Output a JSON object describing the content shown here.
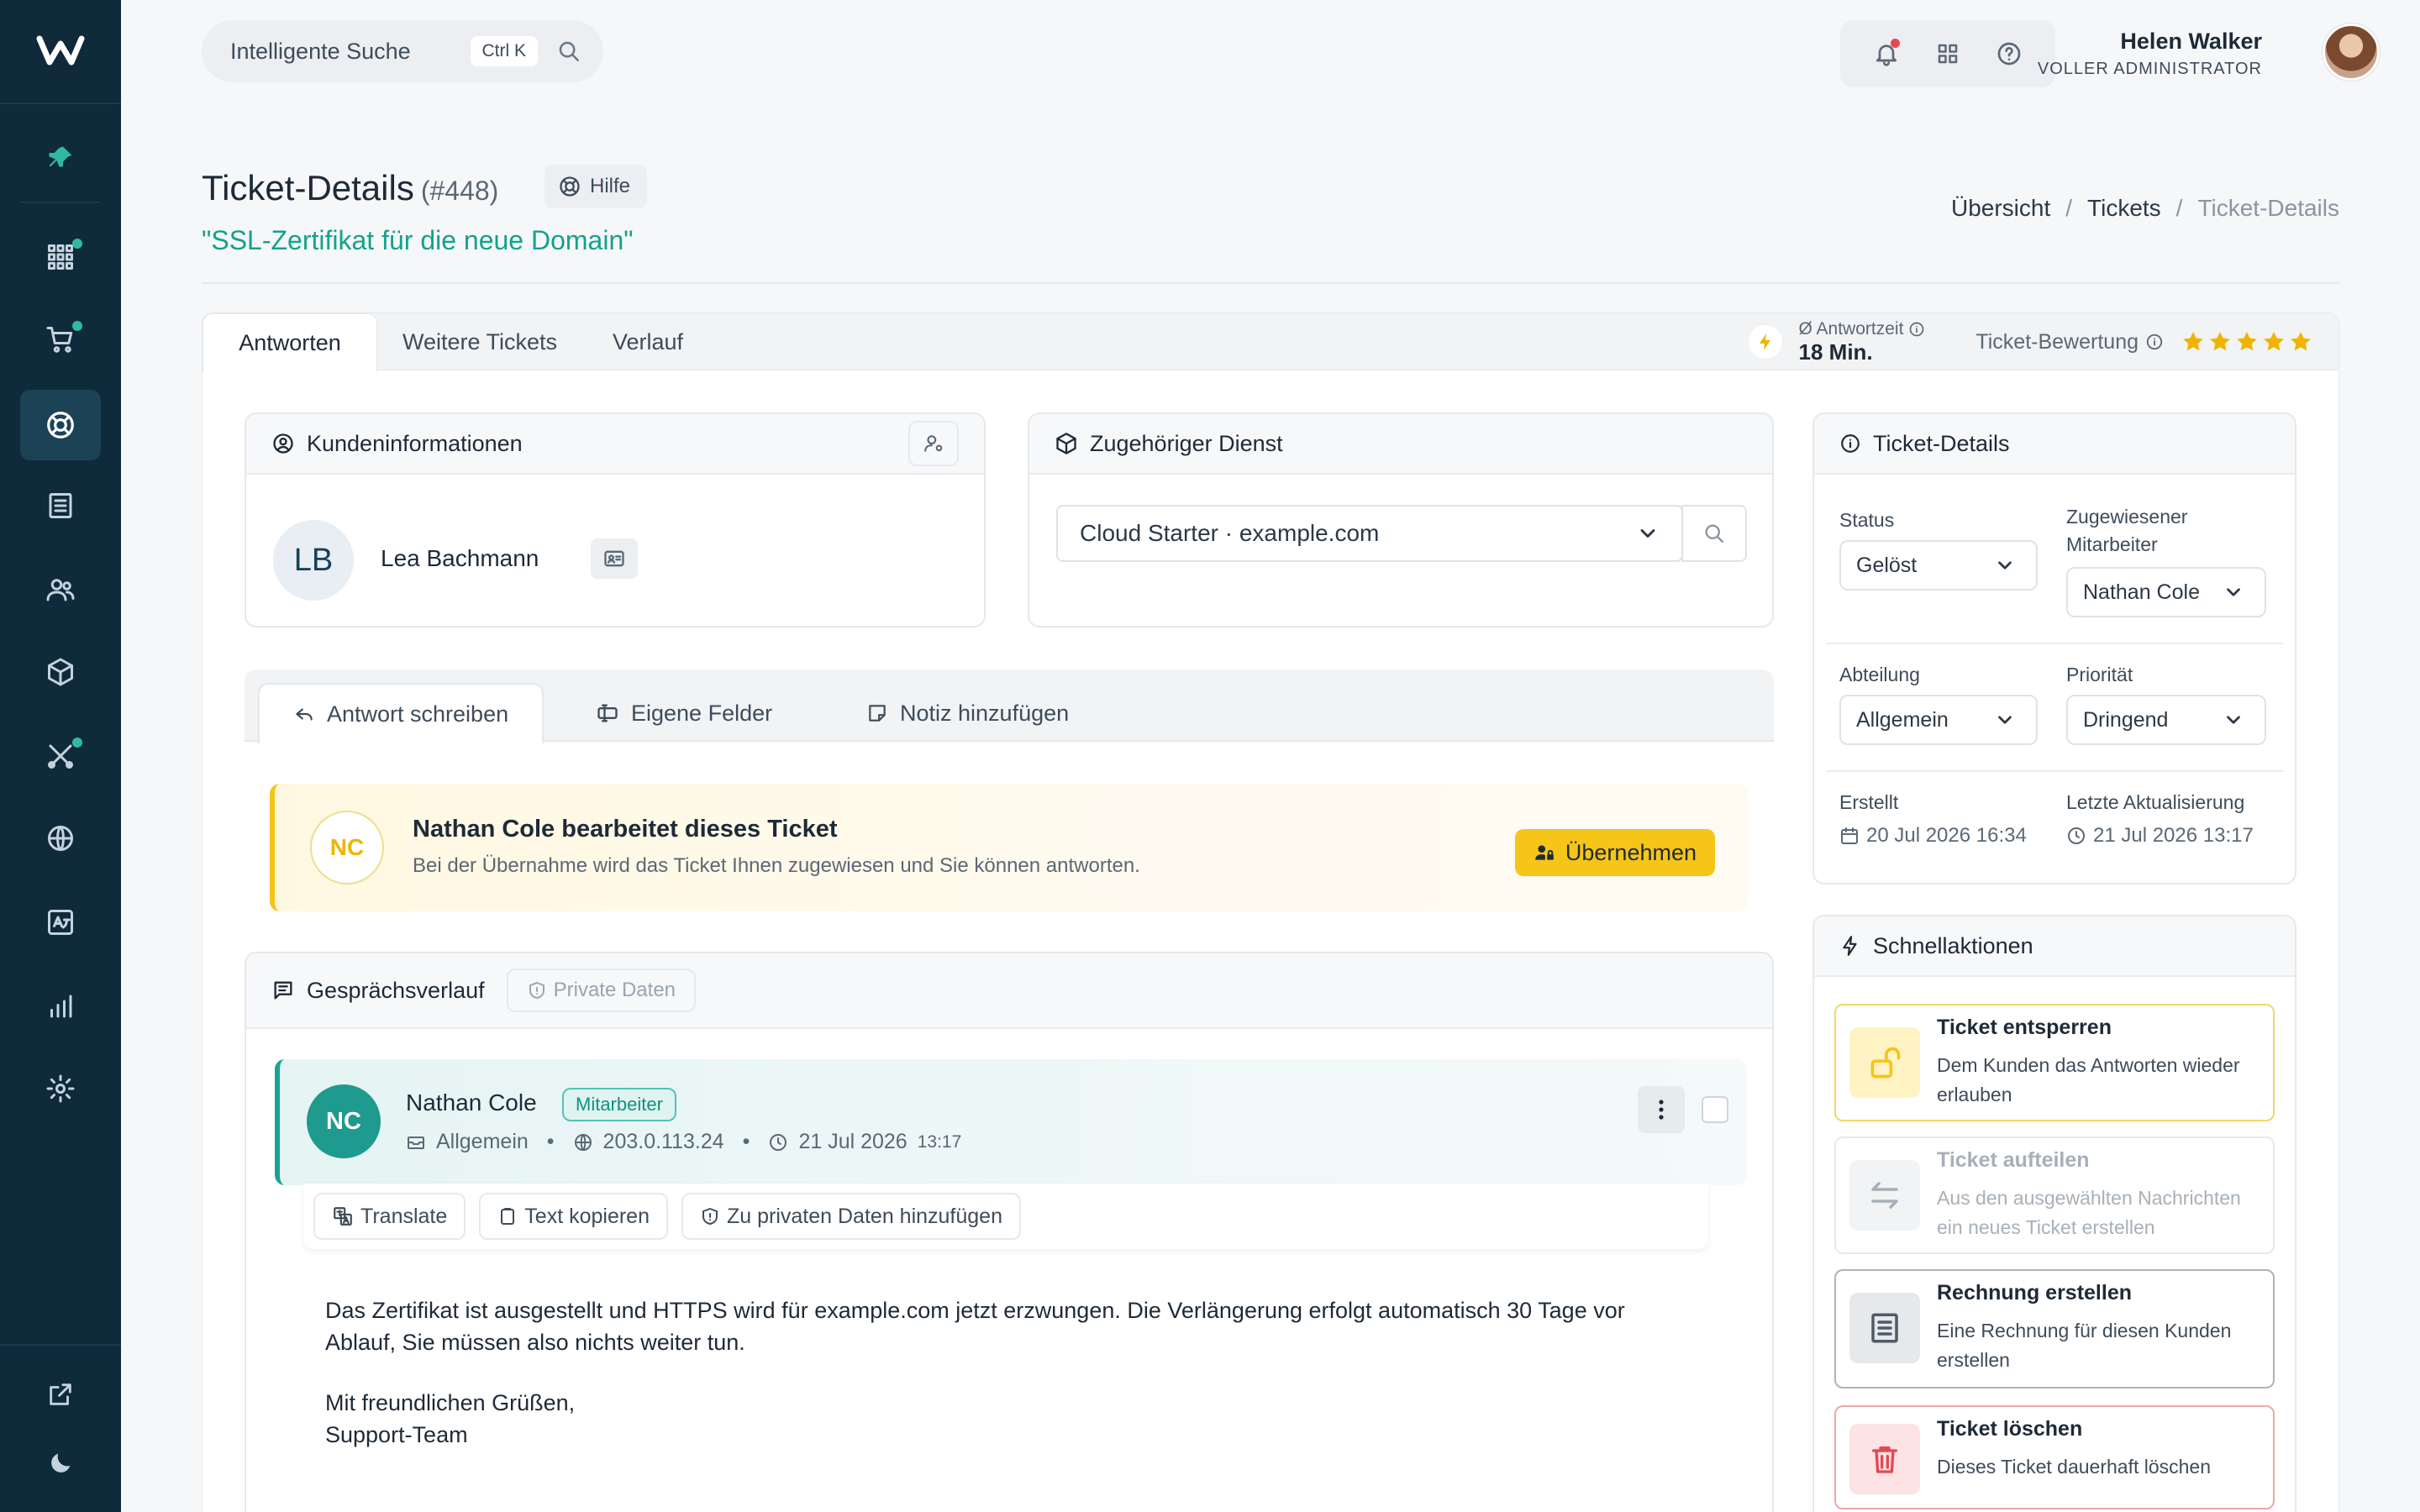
{
  "search": {
    "label": "Intelligente Suche",
    "shortcut": "Ctrl K"
  },
  "user": {
    "name": "Helen Walker",
    "role": "VOLLER ADMINISTRATOR"
  },
  "page": {
    "title": "Ticket-Details",
    "number": "(#448)",
    "help": "Hilfe",
    "subject": "\"SSL-Zertifikat für die neue Domain\""
  },
  "breadcrumb": {
    "item1": "Übersicht",
    "sep": "/",
    "item2": "Tickets",
    "current": "Ticket-Details"
  },
  "tabs": {
    "t1": "Antworten",
    "t2": "Weitere Tickets",
    "t3": "Verlauf"
  },
  "stats": {
    "response_label": "Ø Antwortzeit",
    "response_value": "18 Min.",
    "rating_label": "Ticket-Bewertung",
    "rating": 5
  },
  "customer": {
    "title": "Kundeninformationen",
    "initials": "LB",
    "name": "Lea Bachmann"
  },
  "service": {
    "title": "Zugehöriger Dienst",
    "selected": "Cloud Starter · example.com"
  },
  "reply_tabs": {
    "t1": "Antwort schreiben",
    "t2": "Eigene Felder",
    "t3": "Notiz hinzufügen"
  },
  "lock": {
    "initials": "NC",
    "title": "Nathan Cole bearbeitet dieses Ticket",
    "subtitle": "Bei der Übernahme wird das Ticket Ihnen zugewiesen und Sie können antworten.",
    "button": "Übernehmen"
  },
  "conversation": {
    "title": "Gesprächsverlauf",
    "private": "Private Daten",
    "message": {
      "initials": "NC",
      "author": "Nathan Cole",
      "badge": "Mitarbeiter",
      "department": "Allgemein",
      "ip": "203.0.113.24",
      "date": "21 Jul 2026",
      "time": "13:17",
      "actions": {
        "translate": "Translate",
        "copy": "Text kopieren",
        "private": "Zu privaten Daten hinzufügen"
      },
      "body1": "Das Zertifikat ist ausgestellt und HTTPS wird für example.com jetzt erzwungen. Die Verlängerung erfolgt automatisch 30 Tage vor Ablauf, Sie müssen also nichts weiter tun.",
      "greeting": "Mit freundlichen Grüßen,",
      "signature": "Support-Team"
    }
  },
  "ticket": {
    "title": "Ticket-Details",
    "status_label": "Status",
    "status": "Gelöst",
    "assignee_label": "Zugewiesener Mitarbeiter",
    "assignee": "Nathan Cole",
    "department_label": "Abteilung",
    "department": "Allgemein",
    "priority_label": "Priorität",
    "priority": "Dringend",
    "created_label": "Erstellt",
    "created": "20 Jul 2026 16:34",
    "updated_label": "Letzte Aktualisierung",
    "updated": "21 Jul 2026 13:17"
  },
  "quick": {
    "title": "Schnellaktionen",
    "a1": {
      "title": "Ticket entsperren",
      "desc": "Dem Kunden das Antworten wieder erlauben"
    },
    "a2": {
      "title": "Ticket aufteilen",
      "desc": "Aus den ausgewählten Nachrichten ein neues Ticket erstellen"
    },
    "a3": {
      "title": "Rechnung erstellen",
      "desc": "Eine Rechnung für diesen Kunden erstellen"
    },
    "a4": {
      "title": "Ticket löschen",
      "desc": "Dieses Ticket dauerhaft löschen"
    }
  },
  "colors": {
    "sidebar": "#0f2a3a",
    "accent": "#14a28c",
    "warning": "#f5c518",
    "danger": "#e5484d"
  }
}
